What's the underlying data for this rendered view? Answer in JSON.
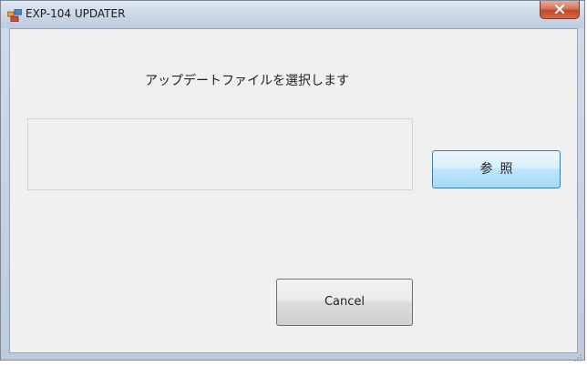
{
  "window": {
    "title": "EXP-104 UPDATER",
    "close_glyph": "x"
  },
  "dialog": {
    "prompt": "アップデートファイルを選択します",
    "file_path": "",
    "browse_label": "参照",
    "cancel_label": "Cancel"
  },
  "icons": {
    "app": "app-icon",
    "close": "close-icon",
    "grip": "resize-grip-icon"
  },
  "colors": {
    "title_bar": "#c9d7e7",
    "client_bg": "#f0f0f0",
    "close_button": "#c4462c",
    "browse_button": "#bee6fd"
  }
}
